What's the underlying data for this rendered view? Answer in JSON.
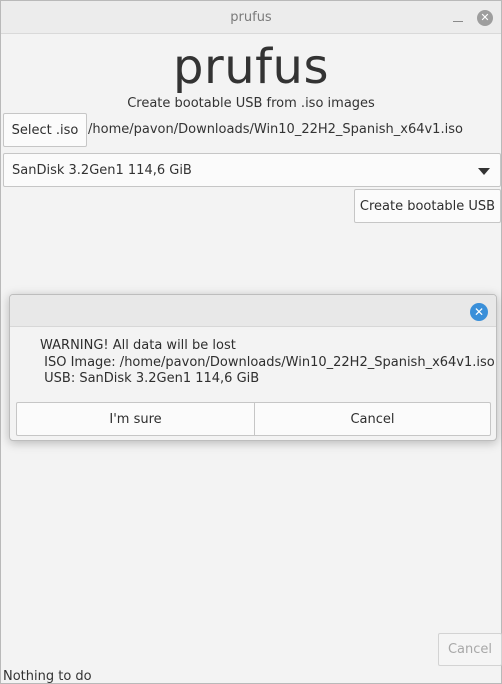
{
  "window": {
    "title": "prufus",
    "minimize_icon": "minimize-icon",
    "close_icon": "close-icon"
  },
  "app": {
    "logo_text": "prufus",
    "subtitle": "Create bootable USB from .iso images",
    "select_iso_label": "Select .iso",
    "iso_path": "/home/pavon/Downloads/Win10_22H2_Spanish_x64v1.iso",
    "device_selected": "SanDisk 3.2Gen1 114,6 GiB",
    "create_usb_label": "Create bootable USB",
    "cancel_label": "Cancel",
    "status_text": "Nothing to do"
  },
  "dialog": {
    "warning_line": "WARNING! All data will be lost",
    "iso_line": " ISO Image: /home/pavon/Downloads/Win10_22H2_Spanish_x64v1.iso",
    "usb_line": " USB: SanDisk 3.2Gen1 114,6 GiB",
    "confirm_label": "I'm sure",
    "cancel_label": "Cancel",
    "close_icon": "close-icon"
  },
  "colors": {
    "accent": "#3a8fd9",
    "window_bg": "#f3f3f3",
    "disabled_text": "#a8a8a8"
  }
}
